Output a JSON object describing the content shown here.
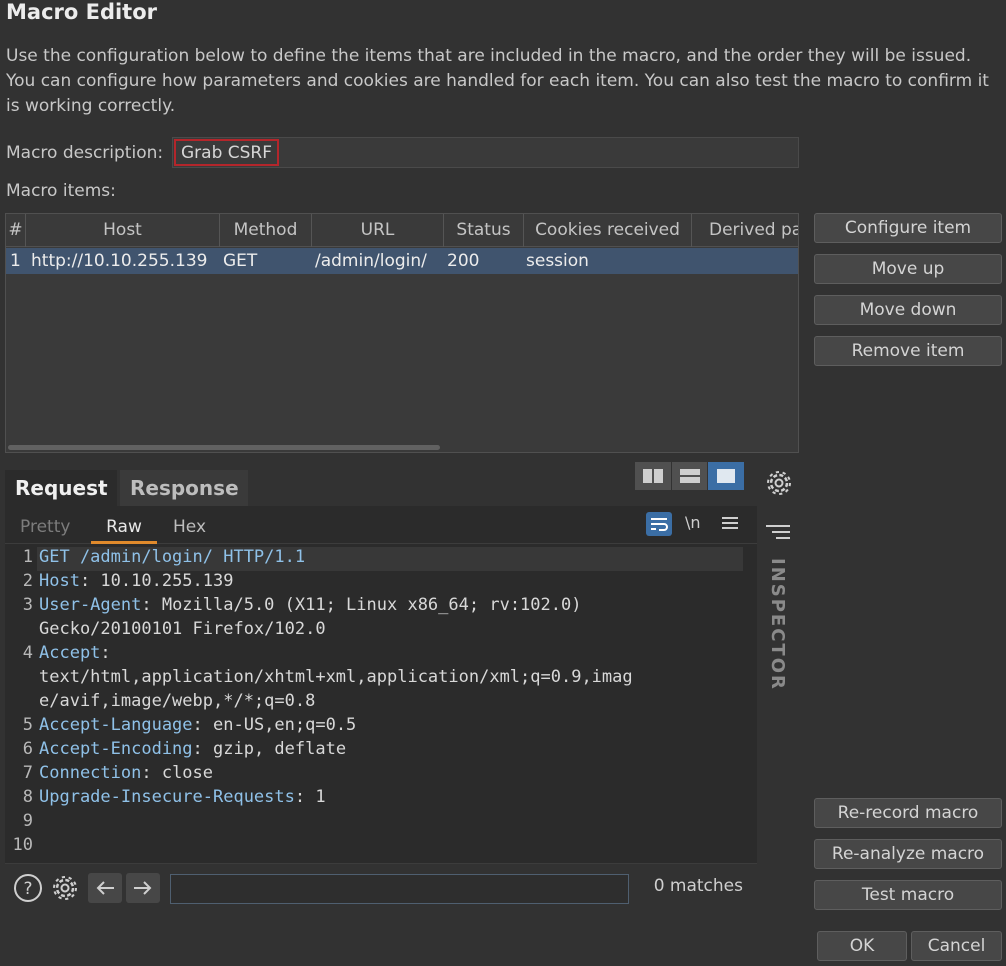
{
  "window": {
    "title": "Macro Editor"
  },
  "intro_text": "Use the configuration below to define the items that are included in the macro, and the order they will be issued. You can configure how parameters and cookies are handled for each item. You can also test the macro to confirm it is working correctly.",
  "description": {
    "label": "Macro description:",
    "value": "Grab CSRF"
  },
  "items": {
    "label": "Macro items:",
    "columns": [
      "#",
      "Host",
      "Method",
      "URL",
      "Status",
      "Cookies received",
      "Derived pa"
    ],
    "rows": [
      {
        "num": "1",
        "host": "http://10.10.255.139",
        "method": "GET",
        "url": "/admin/login/",
        "status": "200",
        "cookies": "session",
        "derived": ""
      }
    ]
  },
  "side_buttons": {
    "configure": "Configure item",
    "move_up": "Move up",
    "move_down": "Move down",
    "remove": "Remove item",
    "rerecord": "Re-record macro",
    "reanalyze": "Re-analyze macro",
    "test": "Test macro"
  },
  "editor": {
    "tabs": [
      "Request",
      "Response"
    ],
    "subtabs": [
      "Pretty",
      "Raw",
      "Hex"
    ],
    "active_subtab": "Raw",
    "newline_toggle": "\\n",
    "lines": [
      {
        "n": "1",
        "k": "GET /admin/login/ HTTP/1.1",
        "v": ""
      },
      {
        "n": "2",
        "k": "Host",
        "v": ": 10.10.255.139"
      },
      {
        "n": "3",
        "k": "User-Agent",
        "v": ": Mozilla/5.0 (X11; Linux x86_64; rv:102.0)"
      },
      {
        "n": "",
        "k": "",
        "v": "Gecko/20100101 Firefox/102.0"
      },
      {
        "n": "4",
        "k": "Accept",
        "v": ":"
      },
      {
        "n": "",
        "k": "",
        "v": "text/html,application/xhtml+xml,application/xml;q=0.9,imag"
      },
      {
        "n": "",
        "k": "",
        "v": "e/avif,image/webp,*/*;q=0.8"
      },
      {
        "n": "5",
        "k": "Accept-Language",
        "v": ": en-US,en;q=0.5"
      },
      {
        "n": "6",
        "k": "Accept-Encoding",
        "v": ": gzip, deflate"
      },
      {
        "n": "7",
        "k": "Connection",
        "v": ": close"
      },
      {
        "n": "8",
        "k": "Upgrade-Insecure-Requests",
        "v": ": 1"
      },
      {
        "n": "9",
        "k": "",
        "v": ""
      },
      {
        "n": "10",
        "k": "",
        "v": ""
      }
    ],
    "search_value": "",
    "matches": "0 matches"
  },
  "inspector_label": "INSPECTOR",
  "dialog": {
    "ok": "OK",
    "cancel": "Cancel"
  },
  "colors": {
    "accent": "#3b6ea5",
    "selected_row": "#40546e",
    "highlight_border": "#b4262b",
    "header_key": "#8fc1e8"
  }
}
